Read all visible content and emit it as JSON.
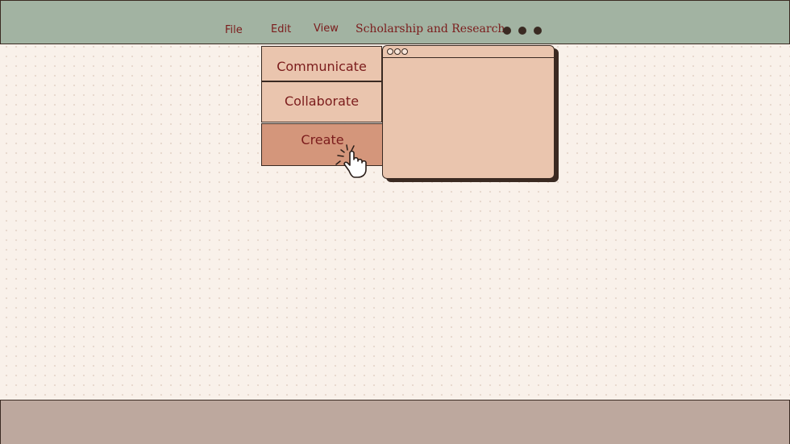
{
  "menubar": {
    "items": [
      "File",
      "Edit",
      "View"
    ],
    "title": "Scholarship and Research",
    "overflow_icon": "more-dots-icon"
  },
  "dropdown": {
    "items": [
      "Communicate",
      "Collaborate",
      "Create"
    ],
    "active_item": "Create"
  },
  "window": {
    "controls_icon": "window-controls-icon"
  },
  "cursor": {
    "icon": "pointer-hand-click-icon"
  },
  "colors": {
    "background": "#f9f1ea",
    "menubar": "#a2b3a2",
    "text_accent": "#7b1c1c",
    "dropdown_item": "#eac5ae",
    "dropdown_active": "#d4967b",
    "footer": "#bda89e",
    "outline": "#3a2a22"
  }
}
